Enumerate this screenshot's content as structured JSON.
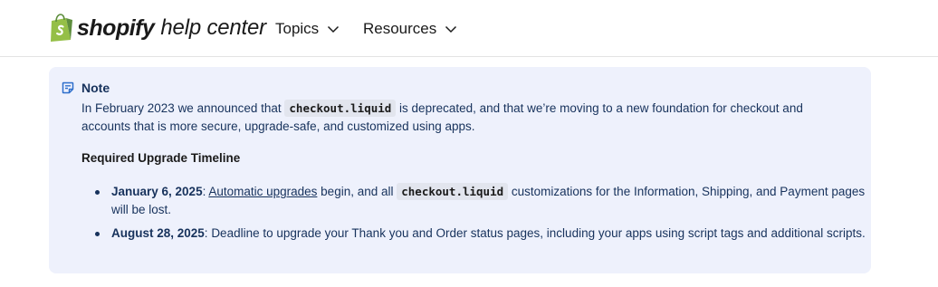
{
  "header": {
    "logo_word": "shopify",
    "logo_sub": "help center",
    "nav": [
      {
        "label": "Topics"
      },
      {
        "label": "Resources"
      }
    ]
  },
  "note": {
    "title": "Note",
    "intro": {
      "before": "In February 2023 we announced that ",
      "code": "checkout.liquid",
      "after": " is deprecated, and that we’re moving to a new foundation for checkout and accounts that is more secure, upgrade-safe, and customized using apps."
    },
    "subheading": "Required Upgrade Timeline",
    "items": [
      {
        "date": "January 6, 2025",
        "colon": ": ",
        "link": "Automatic upgrades",
        "text_a": " begin, and all ",
        "code": "checkout.liquid",
        "text_b": " customizations for the Information, Shipping, and Payment pages will be lost."
      },
      {
        "date": "August 28, 2025",
        "colon": ": ",
        "text": "Deadline to upgrade your Thank you and Order status pages, including your apps using script tags and additional scripts."
      }
    ]
  },
  "colors": {
    "brand_green": "#95bf47",
    "brand_green_dark": "#5e8e3e",
    "callout_bg": "#eef1fc",
    "text_navy": "#17325c"
  },
  "icons": [
    "shopify-bag-icon",
    "chevron-down-icon",
    "note-icon"
  ]
}
